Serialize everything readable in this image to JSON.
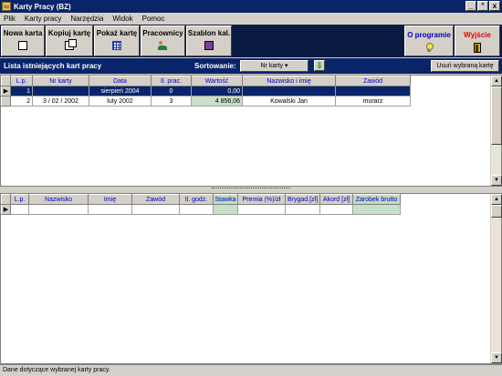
{
  "window": {
    "title": "Karty Pracy (BZ)",
    "minimize": "_",
    "restore": "°",
    "close": "x"
  },
  "menu": [
    "Plik",
    "Karty pracy",
    "Narzędzia",
    "Widok",
    "Pomoc"
  ],
  "toolbar": {
    "nowa_karta": "Nowa karta",
    "kopiuj_karte": "Kopiuj kartę",
    "pokaz_karte": "Pokaż kartę",
    "pracownicy": "Pracownicy",
    "szablon": "Szablon kal.",
    "o_programie": "O programie",
    "wyjscie": "Wyjście"
  },
  "colors": {
    "o_programie": "#0000c0",
    "wyjscie": "#e00000",
    "highlight": "#0a246a"
  },
  "list": {
    "title": "Lista istniejących kart pracy",
    "sort_label": "Sortowanie:",
    "sort_value": "Nr karty",
    "sort_arrow": "⇩",
    "delete_label": "Usuń wybraną kartę",
    "columns": [
      "L.p.",
      "Nr karty",
      "Data",
      "Il. prac.",
      "Wartość",
      "Nazwisko i imię",
      "Zawód"
    ],
    "rows": [
      {
        "lp": "1",
        "nr": "",
        "data": "sierpień 2004",
        "il": "0",
        "wartosc": "0,00",
        "nazwisko": "",
        "zawod": ""
      },
      {
        "lp": "2",
        "nr": "3 / 02 / 2002",
        "data": "luty 2002",
        "il": "3",
        "wartosc": "4 856,06",
        "nazwisko": "Kowalski Jan",
        "zawod": "murarz"
      }
    ]
  },
  "details": {
    "columns": [
      "L.p.",
      "Nazwisko",
      "Imię",
      "Zawód",
      "Il. godz.",
      "Stawka",
      "Premia (%)/zł",
      "Brygad.[zł]",
      "Akord [zł]",
      "Zarobek brutto"
    ]
  },
  "status": "Dane dotyczące wybranej karty pracy.",
  "icons": {
    "nowa": "new-document-icon",
    "kopiuj": "copy-icon",
    "pokaz": "calendar-grid-icon",
    "pracownicy": "people-icon",
    "szablon": "template-icon",
    "info": "lightbulb-icon",
    "exit": "door-icon"
  }
}
